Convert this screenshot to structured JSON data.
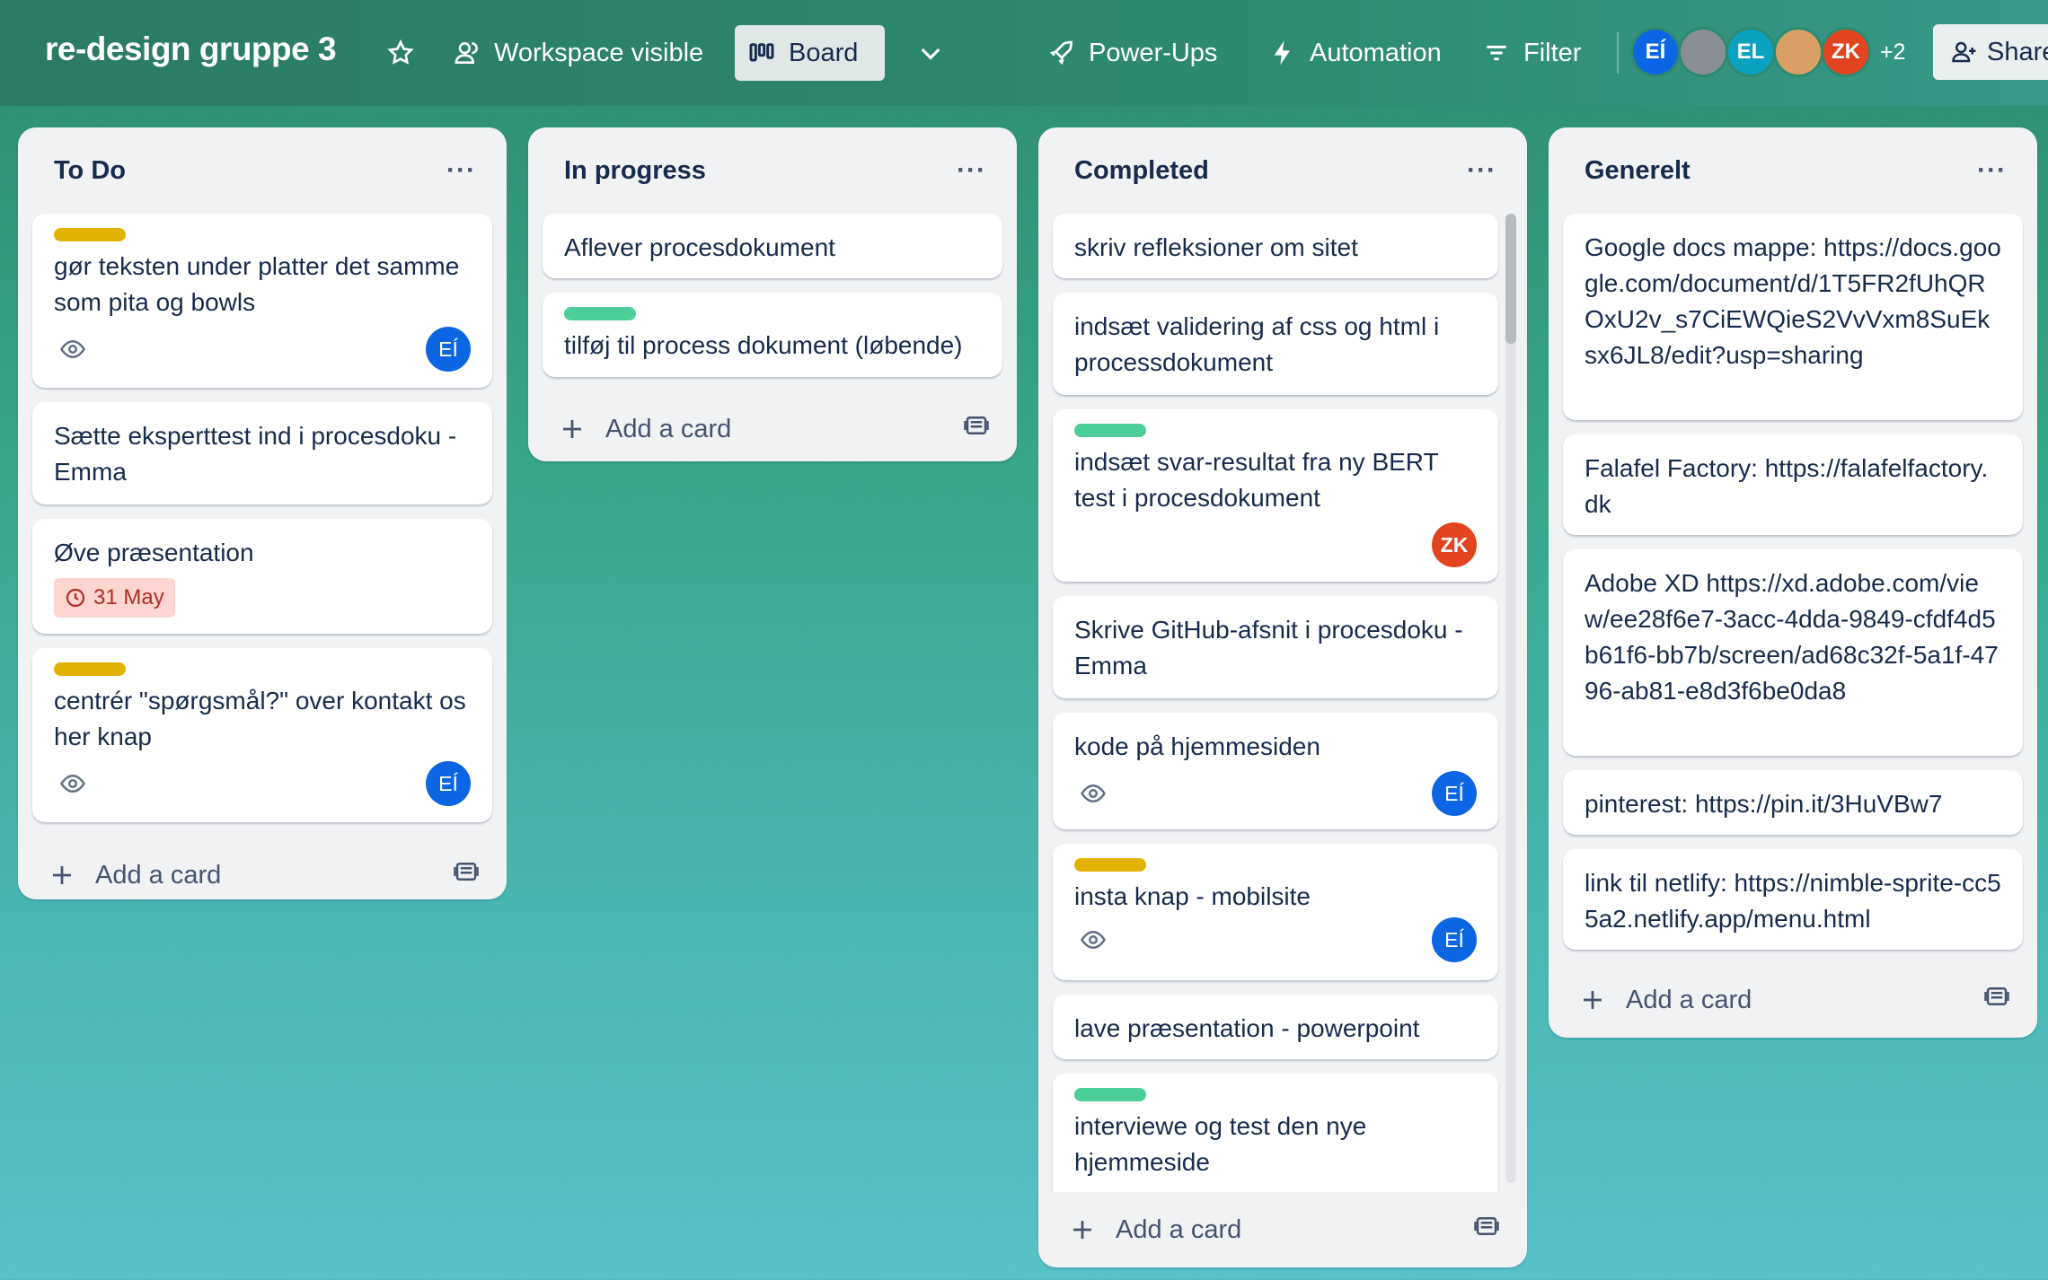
{
  "header": {
    "board_title": "re-design gruppe 3",
    "visibility_label": "Workspace visible",
    "view_label": "Board",
    "powerups_label": "Power-Ups",
    "automation_label": "Automation",
    "filter_label": "Filter",
    "members": [
      {
        "initials": "EÍ",
        "color": "#0c66e4"
      },
      {
        "initials": "",
        "color": "#8a8f96"
      },
      {
        "initials": "EL",
        "color": "#0aa2c0"
      },
      {
        "initials": "",
        "color": "#d9a066"
      },
      {
        "initials": "ZK",
        "color": "#e2441f"
      }
    ],
    "extra_members": "+2",
    "share_label": "Share"
  },
  "lists": [
    {
      "title": "To Do",
      "add_card": "Add a card",
      "cards": [
        {
          "label": "#e2b203",
          "text": "gør teksten under platter det samme som pita og bowls",
          "watch": true,
          "member": "EÍ"
        },
        {
          "text": "Sætte eksperttest ind i procesdoku - Emma"
        },
        {
          "text": "Øve præsentation",
          "due": "31 May"
        },
        {
          "label": "#e2b203",
          "text": "centrér \"spørgsmål?\" over kontakt os her knap",
          "watch": true,
          "member": "EÍ"
        }
      ]
    },
    {
      "title": "In progress",
      "add_card": "Add a card",
      "cards": [
        {
          "text": "Aflever procesdokument"
        },
        {
          "label": "#4bce97",
          "text": "tilføj til process dokument (løbende)"
        }
      ]
    },
    {
      "title": "Completed",
      "add_card": "Add a card",
      "cards": [
        {
          "text": "skriv refleksioner om sitet"
        },
        {
          "text": "indsæt validering af css og html i processdokument"
        },
        {
          "label": "#4bce97",
          "text": "indsæt svar-resultat fra ny BERT test i procesdokument",
          "member": "ZK"
        },
        {
          "text": "Skrive GitHub-afsnit i procesdoku - Emma"
        },
        {
          "text": "kode på hjemmesiden",
          "watch": true,
          "member": "EÍ"
        },
        {
          "label": "#e2b203",
          "text": "insta knap - mobilsite",
          "watch": true,
          "member": "EÍ"
        },
        {
          "text": "lave præsentation - powerpoint"
        },
        {
          "label": "#4bce97",
          "text": "interviewe og test den nye hjemmeside"
        }
      ]
    },
    {
      "title": "Generelt",
      "add_card": "Add a card",
      "cards": [
        {
          "text": "Google docs mappe: https://docs.google.com/document/d/1T5FR2fUhQROxU2v_s7CiEWQieS2VvVxm8SuEksx6JL8/edit?usp=sharing"
        },
        {
          "text": "Falafel Factory: https://falafelfactory.dk"
        },
        {
          "text": "Adobe XD https://xd.adobe.com/view/ee28f6e7-3acc-4dda-9849-cfdf4d5b61f6-bb7b/screen/ad68c32f-5a1f-4796-ab81-e8d3f6be0da8"
        },
        {
          "text": "pinterest: https://pin.it/3HuVBw7"
        },
        {
          "text": "link til netlify: https://nimble-sprite-cc55a2.netlify.app/menu.html"
        }
      ]
    }
  ],
  "colors": {
    "label_yellow": "#e2b203",
    "label_green": "#4bce97",
    "member_blue": "#0c66e4",
    "member_orange": "#e2441f"
  }
}
